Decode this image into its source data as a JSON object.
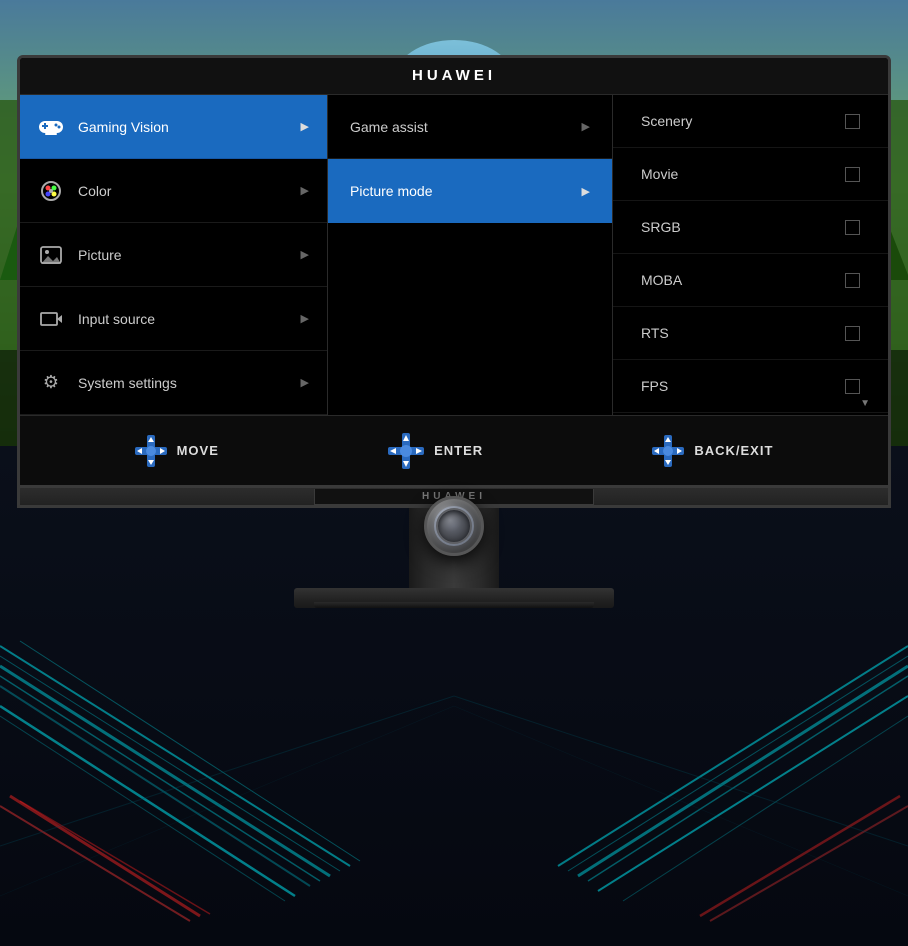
{
  "brand": "HUAWEI",
  "titleBar": {
    "label": "HUAWEI"
  },
  "bottomBrand": "HUAWEI",
  "menu": {
    "leftPanel": {
      "items": [
        {
          "id": "gaming-vision",
          "icon": "gamepad",
          "label": "Gaming Vision",
          "active": true
        },
        {
          "id": "color",
          "icon": "palette",
          "label": "Color",
          "active": false
        },
        {
          "id": "picture",
          "icon": "image",
          "label": "Picture",
          "active": false
        },
        {
          "id": "input-source",
          "icon": "input",
          "label": "Input source",
          "active": false
        },
        {
          "id": "system-settings",
          "icon": "gear",
          "label": "System settings",
          "active": false
        }
      ]
    },
    "middlePanel": {
      "items": [
        {
          "id": "game-assist",
          "label": "Game assist",
          "active": false
        },
        {
          "id": "picture-mode",
          "label": "Picture mode",
          "active": true
        }
      ]
    },
    "rightPanel": {
      "items": [
        {
          "id": "scenery",
          "label": "Scenery"
        },
        {
          "id": "movie",
          "label": "Movie"
        },
        {
          "id": "srgb",
          "label": "SRGB"
        },
        {
          "id": "moba",
          "label": "MOBA"
        },
        {
          "id": "rts",
          "label": "RTS"
        },
        {
          "id": "fps",
          "label": "FPS"
        }
      ],
      "scrollIndicator": "▼"
    }
  },
  "navigationBar": {
    "move": {
      "icon": "dpad",
      "label": "MOVE"
    },
    "enter": {
      "icon": "dpad-enter",
      "label": "ENTER"
    },
    "backExit": {
      "icon": "dpad-back",
      "label": "BACK/EXIT"
    }
  },
  "icons": {
    "gamepad": "🎮",
    "palette": "🎨",
    "image": "🖼",
    "input": "↩",
    "gear": "⚙"
  }
}
